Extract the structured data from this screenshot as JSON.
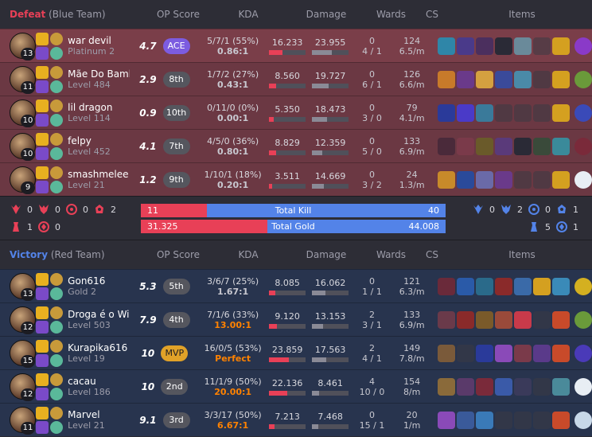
{
  "headers": {
    "op_score": "OP Score",
    "kda": "KDA",
    "damage": "Damage",
    "wards": "Wards",
    "cs": "CS",
    "items": "Items"
  },
  "defeat": {
    "result": "Defeat",
    "team": "(Blue Team)",
    "color": "#e84057",
    "players": [
      {
        "name": "war devil",
        "rank": "Platinum 2",
        "level": "13",
        "op": "4.7",
        "badge": "ACE",
        "kda": "5/7/1 (55%)",
        "ratio": "0.86:1",
        "dealt": "16.233",
        "dealt_frac": 0.37,
        "taken": "23.955",
        "taken_frac": 0.55,
        "wards": "0",
        "wards_detail": "4 / 1",
        "cs": "124",
        "csm": "6.5/m",
        "items": [
          "#2f86a8",
          "#4a3a8a",
          "#4b2f5e",
          "#2a2a36",
          "#6a8a9a",
          "#3a3a44",
          "#d4a020",
          "#8a3ac8"
        ]
      },
      {
        "name": "Mãe Do Bambi",
        "rank": "Level 484",
        "level": "11",
        "op": "2.9",
        "badge": "8th",
        "kda": "1/7/2 (27%)",
        "ratio": "0.43:1",
        "dealt": "8.560",
        "dealt_frac": 0.2,
        "taken": "19.727",
        "taken_frac": 0.45,
        "wards": "0",
        "wards_detail": "6 / 1",
        "cs": "126",
        "csm": "6.6/m",
        "items": [
          "#c87a2a",
          "#6a3a8a",
          "#d4a040",
          "#3a4a9a",
          "#4a8aa8",
          "#3a3a44",
          "#d4a020",
          "#6a9a3a"
        ]
      },
      {
        "name": "lil dragon",
        "rank": "Level 114",
        "level": "10",
        "op": "0.9",
        "badge": "10th",
        "kda": "0/11/0 (0%)",
        "ratio": "0.00:1",
        "dealt": "5.350",
        "dealt_frac": 0.12,
        "taken": "18.473",
        "taken_frac": 0.42,
        "wards": "0",
        "wards_detail": "3 / 0",
        "cs": "79",
        "csm": "4.1/m",
        "items": [
          "#2a3a9a",
          "#4a3ac8",
          "#3a7a9a",
          "#3a3a44",
          "#3a3a44",
          "#3a3a44",
          "#d4a020",
          "#3a4ab8"
        ]
      },
      {
        "name": "felpy",
        "rank": "Level 452",
        "level": "10",
        "op": "4.1",
        "badge": "7th",
        "kda": "4/5/0 (36%)",
        "ratio": "0.80:1",
        "dealt": "8.829",
        "dealt_frac": 0.2,
        "taken": "12.359",
        "taken_frac": 0.28,
        "wards": "0",
        "wards_detail": "5 / 0",
        "cs": "133",
        "csm": "6.9/m",
        "items": [
          "#4a2a3a",
          "#7a3a4a",
          "#6a5a2a",
          "#5a3a7a",
          "#2a2a36",
          "#3a4a3a",
          "#3a8a9a",
          "#7a2a3a"
        ]
      },
      {
        "name": "smashmelee",
        "rank": "Level 21",
        "level": "9",
        "op": "1.2",
        "badge": "9th",
        "kda": "1/10/1 (18%)",
        "ratio": "0.20:1",
        "dealt": "3.511",
        "dealt_frac": 0.08,
        "taken": "14.669",
        "taken_frac": 0.33,
        "wards": "0",
        "wards_detail": "3 / 2",
        "cs": "24",
        "csm": "1.3/m",
        "items": [
          "#c88a2a",
          "#2a4a9a",
          "#6a6aa8",
          "#6a3a8a",
          "#3a3a44",
          "#3a3a44",
          "#d4a020",
          "#e8eef4"
        ]
      }
    ]
  },
  "summary": {
    "blue_objectives": {
      "baron": "0",
      "dragon": "0",
      "herald": "0",
      "grubs": "2",
      "tower": "1",
      "inhib": "0"
    },
    "red_objectives": {
      "baron": "0",
      "dragon": "2",
      "herald": "0",
      "grubs": "1",
      "tower": "5",
      "inhib": "1"
    },
    "total_kill": {
      "label": "Total Kill",
      "blue": "11",
      "red": "40",
      "blue_share": 0.216
    },
    "total_gold": {
      "label": "Total Gold",
      "blue": "31.325",
      "red": "44.008",
      "blue_share": 0.416
    }
  },
  "victory": {
    "result": "Victory",
    "team": "(Red Team)",
    "color": "#5383e8",
    "players": [
      {
        "name": "Gon616",
        "rank": "Gold 2",
        "level": "13",
        "op": "5.3",
        "badge": "5th",
        "kda": "3/6/7 (25%)",
        "ratio": "1.67:1",
        "dealt": "8.085",
        "dealt_frac": 0.18,
        "taken": "16.062",
        "taken_frac": 0.36,
        "wards": "0",
        "wards_detail": "1 / 1",
        "cs": "121",
        "csm": "6.3/m",
        "items": [
          "#6a2a3a",
          "#2a5aa8",
          "#2a6a8a",
          "#8a2a2a",
          "#3a6aa8",
          "#d4a020",
          "#3a8ab8",
          "#d4b020"
        ]
      },
      {
        "name": "Droga é o Will",
        "rank": "Level 503",
        "level": "12",
        "op": "7.9",
        "badge": "4th",
        "kda": "7/1/6 (33%)",
        "ratio": "13.00:1",
        "dealt": "9.120",
        "dealt_frac": 0.21,
        "taken": "13.153",
        "taken_frac": 0.3,
        "wards": "2",
        "wards_detail": "3 / 1",
        "cs": "133",
        "csm": "6.9/m",
        "items": [
          "#6a3a4a",
          "#8a2a2a",
          "#7a5a2a",
          "#9a4a3a",
          "#c83a4a",
          "#3a3a44",
          "#c84a2a",
          "#6a9a3a"
        ]
      },
      {
        "name": "Kurapika616",
        "rank": "Level 19",
        "level": "15",
        "op": "10",
        "badge": "MVP",
        "kda": "16/0/5 (53%)",
        "ratio": "Perfect",
        "dealt": "23.859",
        "dealt_frac": 0.54,
        "taken": "17.563",
        "taken_frac": 0.4,
        "wards": "2",
        "wards_detail": "4 / 1",
        "cs": "149",
        "csm": "7.8/m",
        "items": [
          "#7a5a3a",
          "#3a3a44",
          "#2a3a9a",
          "#8a4ab8",
          "#7a3a4a",
          "#5a3a8a",
          "#c84a2a",
          "#4a3ab8"
        ]
      },
      {
        "name": "cacau",
        "rank": "Level 186",
        "level": "12",
        "op": "10",
        "badge": "2nd",
        "kda": "11/1/9 (50%)",
        "ratio": "20.00:1",
        "dealt": "22.136",
        "dealt_frac": 0.5,
        "taken": "8.461",
        "taken_frac": 0.19,
        "wards": "4",
        "wards_detail": "10 / 0",
        "cs": "154",
        "csm": "8/m",
        "items": [
          "#8a6a3a",
          "#5a3a6a",
          "#7a2a3a",
          "#3a5aa8",
          "#3a3a5a",
          "#3a3a44",
          "#4a8a9a",
          "#e8eef4"
        ]
      },
      {
        "name": "Marvel",
        "rank": "Level 21",
        "level": "11",
        "op": "9.1",
        "badge": "3rd",
        "kda": "3/3/17 (50%)",
        "ratio": "6.67:1",
        "dealt": "7.213",
        "dealt_frac": 0.16,
        "taken": "7.468",
        "taken_frac": 0.17,
        "wards": "0",
        "wards_detail": "15 / 1",
        "cs": "20",
        "csm": "1/m",
        "items": [
          "#8a4ab8",
          "#3a5a9a",
          "#3a7ab8",
          "#3a3a44",
          "#3a3a44",
          "#3a3a44",
          "#c84a2a",
          "#c8d8e8"
        ]
      }
    ]
  }
}
